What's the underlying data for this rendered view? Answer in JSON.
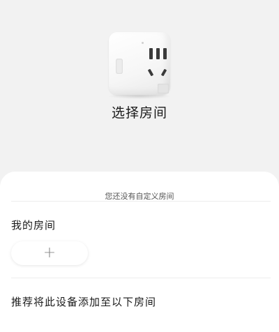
{
  "header": {
    "title": "选择房间"
  },
  "device": {
    "image": "smart-plug-image"
  },
  "sheet": {
    "hint": "您还没有自定义房间",
    "my_rooms_title": "我的房间",
    "add_room_icon": "+",
    "recommend_title": "推荐将此设备添加至以下房间"
  }
}
